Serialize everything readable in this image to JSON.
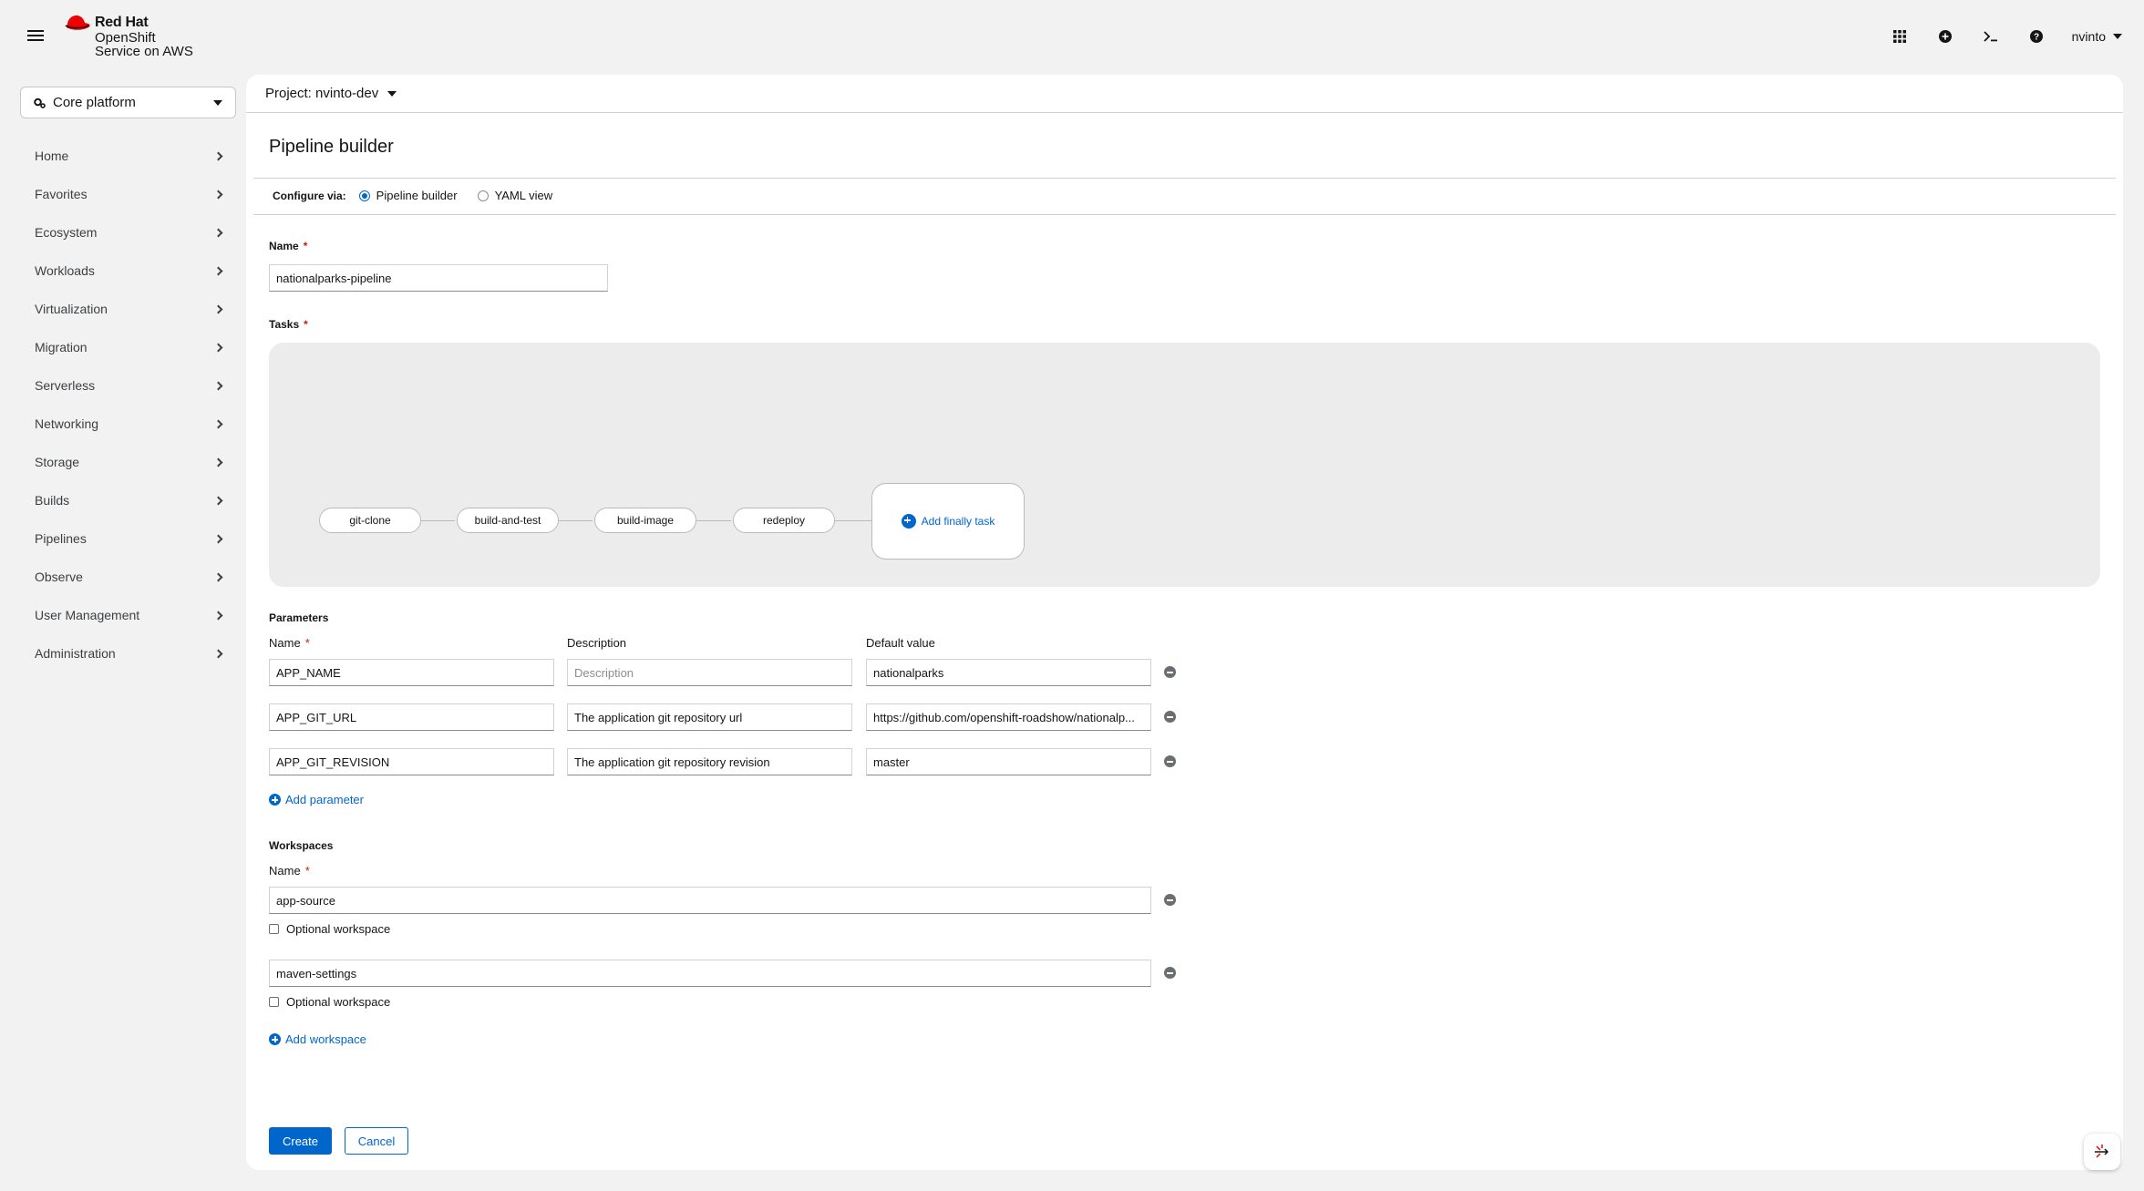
{
  "masthead": {
    "brand_line1": "Red Hat",
    "brand_line2": "OpenShift",
    "brand_line3": "Service on AWS",
    "user": "nvinto",
    "icons": [
      "hamburger-icon",
      "app-launcher-icon",
      "add-icon",
      "terminal-icon",
      "help-icon"
    ]
  },
  "sidebar": {
    "perspective": "Core platform",
    "items": [
      {
        "label": "Home"
      },
      {
        "label": "Favorites"
      },
      {
        "label": "Ecosystem"
      },
      {
        "label": "Workloads"
      },
      {
        "label": "Virtualization"
      },
      {
        "label": "Migration"
      },
      {
        "label": "Serverless"
      },
      {
        "label": "Networking"
      },
      {
        "label": "Storage"
      },
      {
        "label": "Builds"
      },
      {
        "label": "Pipelines"
      },
      {
        "label": "Observe"
      },
      {
        "label": "User Management"
      },
      {
        "label": "Administration"
      }
    ]
  },
  "main": {
    "project": "Project: nvinto-dev",
    "title": "Pipeline builder",
    "configure_label": "Configure via:",
    "configure_options": [
      {
        "label": "Pipeline builder",
        "selected": true
      },
      {
        "label": "YAML view",
        "selected": false
      }
    ],
    "name_label": "Name",
    "required_mark": "*",
    "name_value": "nationalparks-pipeline",
    "tasks_label": "Tasks",
    "tasks": [
      "git-clone",
      "build-and-test",
      "build-image",
      "redeploy"
    ],
    "add_finally": "Add finally task",
    "parameters": {
      "section_label": "Parameters",
      "col_name": "Name",
      "col_description": "Description",
      "col_default": "Default value",
      "description_placeholder": "Description",
      "rows": [
        {
          "name": "APP_NAME",
          "description": "",
          "default": "nationalparks"
        },
        {
          "name": "APP_GIT_URL",
          "description": "The application git repository url",
          "default": "https://github.com/openshift-roadshow/nationalp..."
        },
        {
          "name": "APP_GIT_REVISION",
          "description": "The application git repository revision",
          "default": "master"
        }
      ],
      "add_label": "Add parameter"
    },
    "workspaces": {
      "section_label": "Workspaces",
      "col_name": "Name",
      "rows": [
        {
          "name": "app-source",
          "optional_label": "Optional workspace"
        },
        {
          "name": "maven-settings",
          "optional_label": "Optional workspace"
        }
      ],
      "add_label": "Add workspace"
    },
    "create_label": "Create",
    "cancel_label": "Cancel"
  },
  "colors": {
    "accent": "#0066cc",
    "brand_red": "#ee0000",
    "danger": "#c9190b"
  }
}
